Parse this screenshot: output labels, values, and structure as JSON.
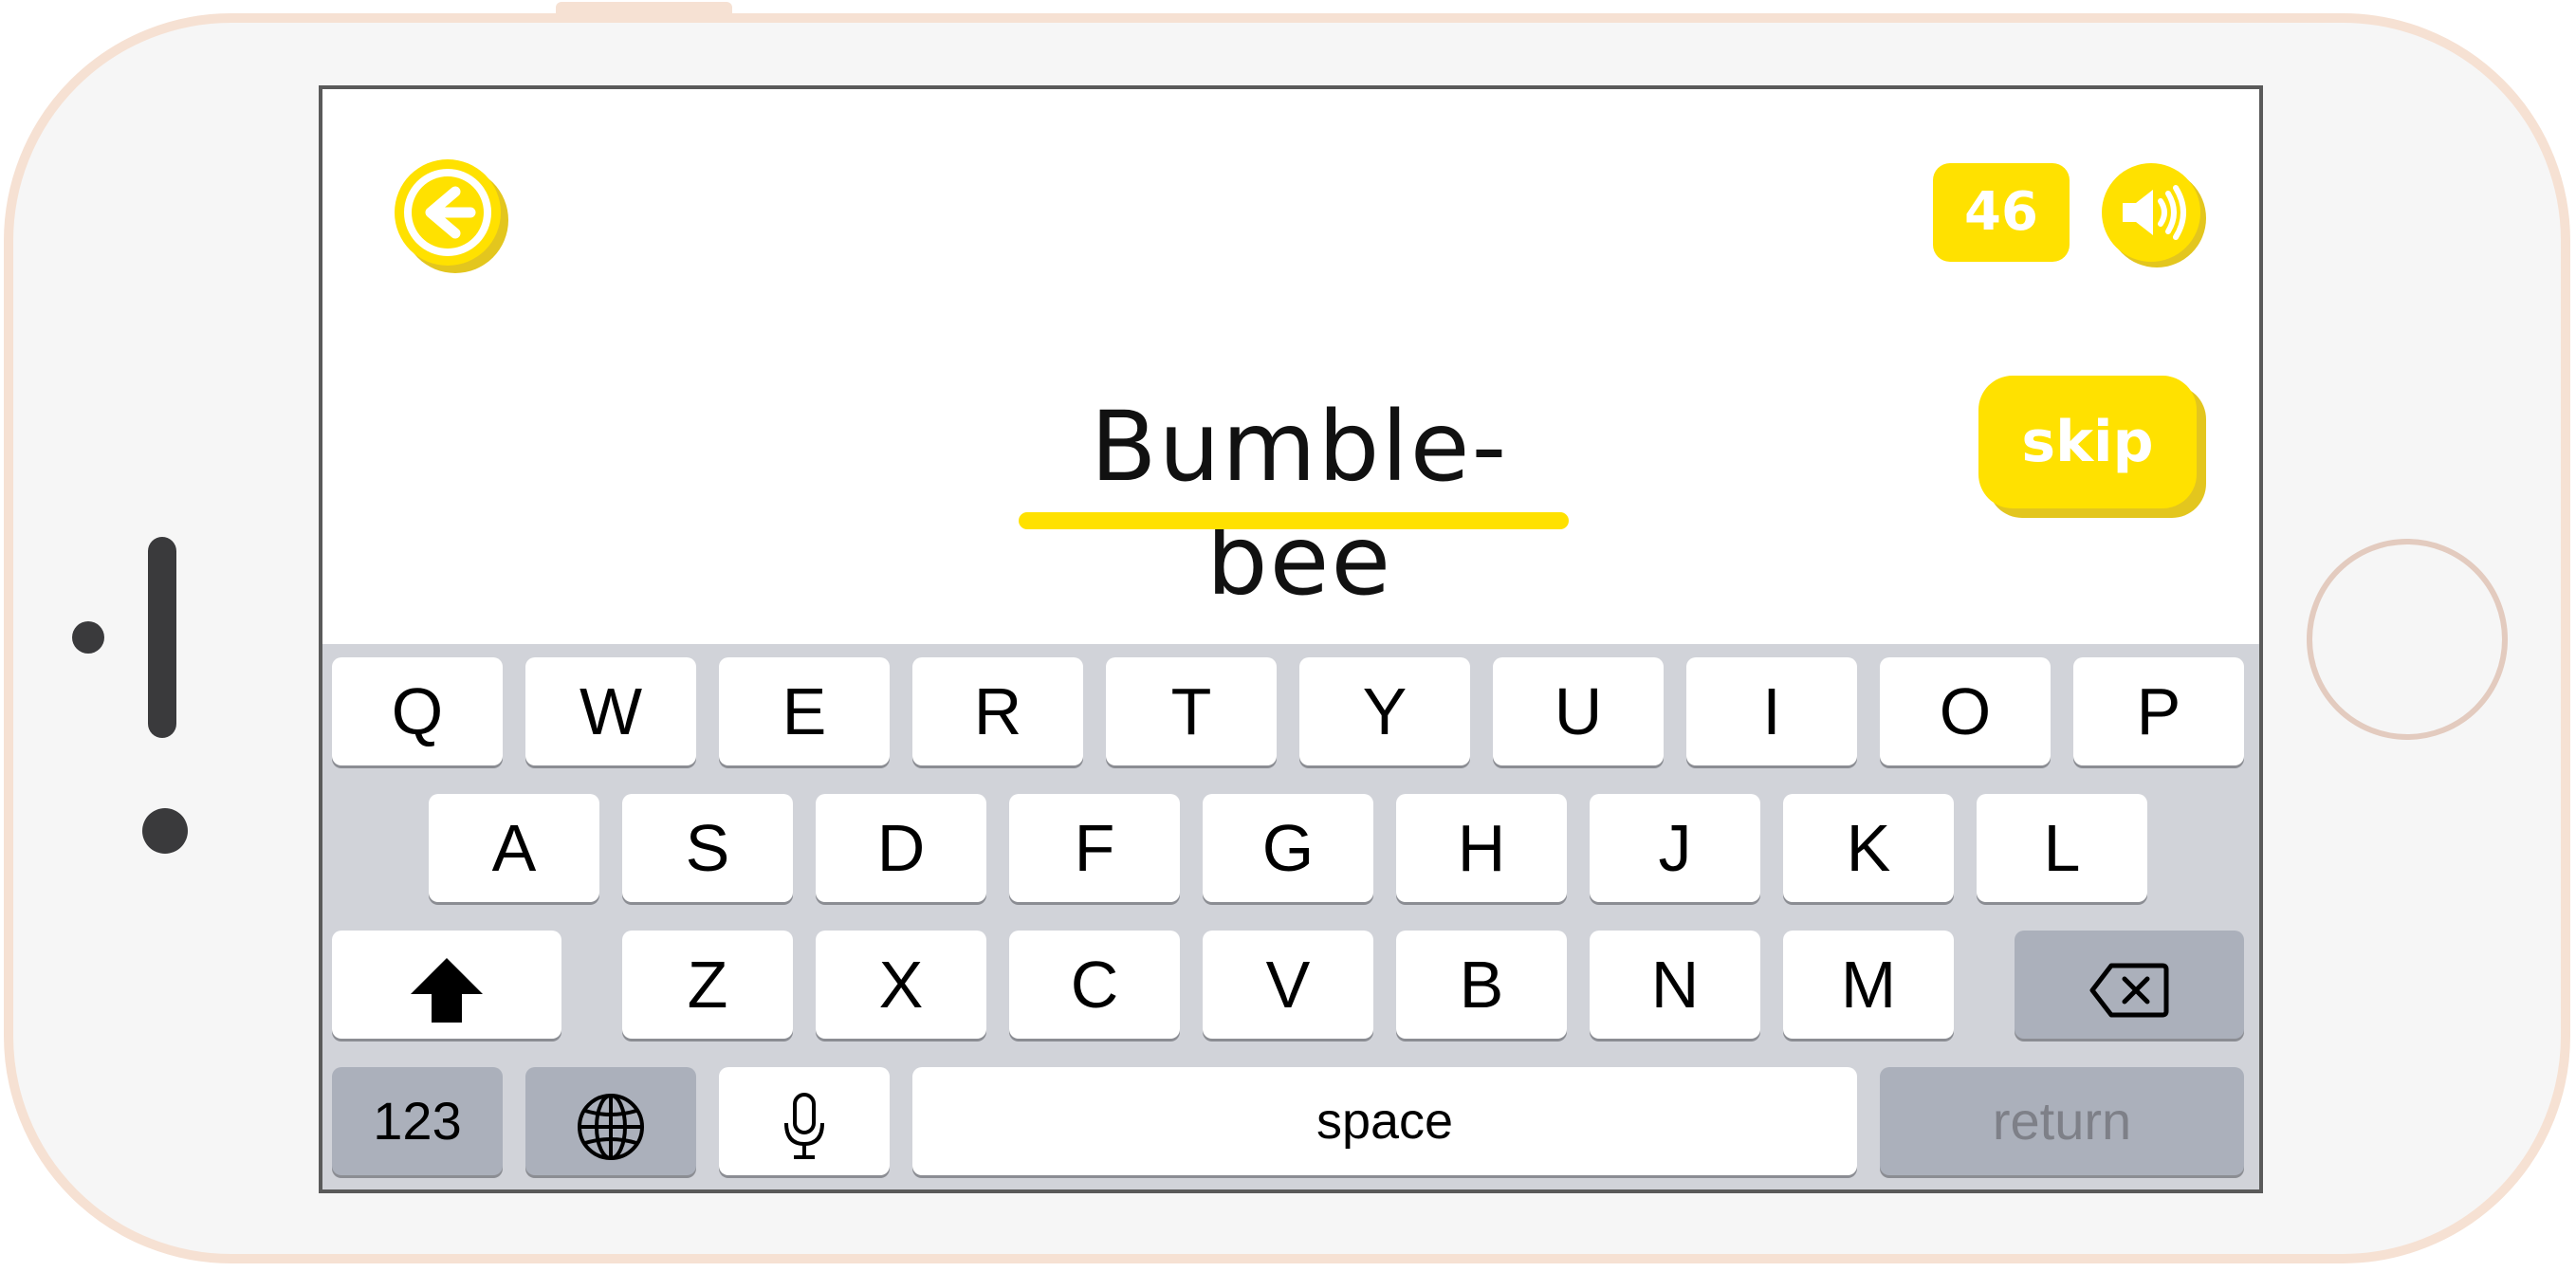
{
  "colors": {
    "accent": "#ffe100",
    "accent_shadow": "#e3c61e",
    "phone_rim": "#f6e1d3",
    "keyboard_bg": "#d1d3d9",
    "key_bg": "#ffffff",
    "special_key_bg": "#abb0bb"
  },
  "header": {
    "back_icon": "arrow-left-circle-icon",
    "score": "46",
    "sound_icon": "speaker-icon"
  },
  "main": {
    "word": "Bumble-bee",
    "skip_label": "skip"
  },
  "keyboard": {
    "row1": [
      "Q",
      "W",
      "E",
      "R",
      "T",
      "Y",
      "U",
      "I",
      "O",
      "P"
    ],
    "row2": [
      "A",
      "S",
      "D",
      "F",
      "G",
      "H",
      "J",
      "K",
      "L"
    ],
    "row3": [
      "Z",
      "X",
      "C",
      "V",
      "B",
      "N",
      "M"
    ],
    "shift_icon": "shift-arrow-icon",
    "backspace_icon": "backspace-icon",
    "num_label": "123",
    "globe_icon": "globe-icon",
    "mic_icon": "microphone-icon",
    "space_label": "space",
    "return_label": "return"
  }
}
